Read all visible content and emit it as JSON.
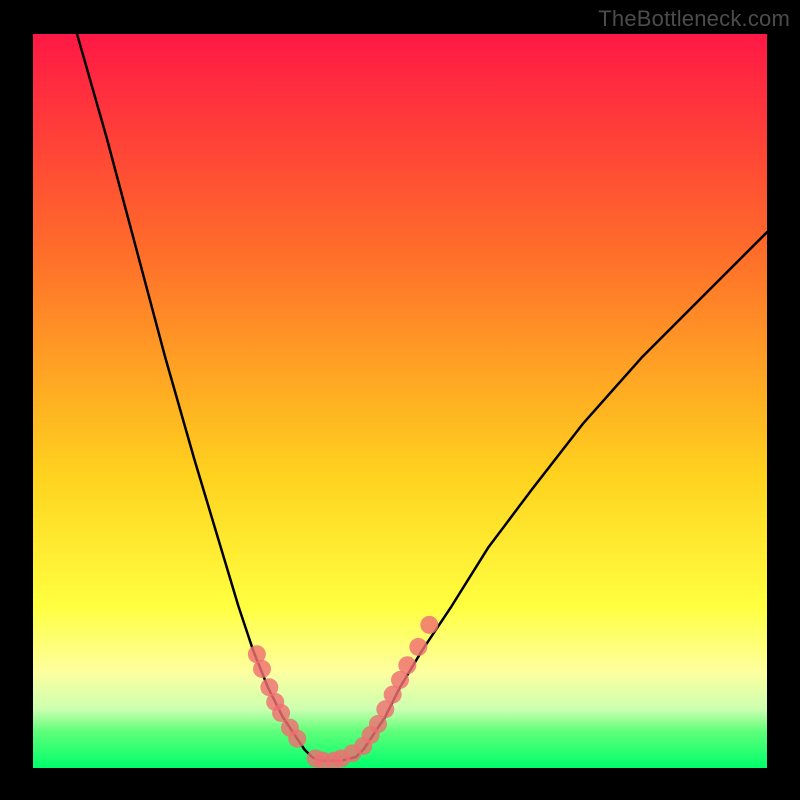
{
  "watermark": "TheBottleneck.com",
  "chart_data": {
    "type": "line",
    "title": "",
    "xlabel": "",
    "ylabel": "",
    "xlim": [
      0,
      100
    ],
    "ylim": [
      0,
      100
    ],
    "series": [
      {
        "name": "bottleneck-curve",
        "color": "#000000",
        "x": [
          6,
          10,
          14,
          18,
          22,
          25,
          28,
          30,
          32,
          34,
          36,
          37,
          38,
          39,
          40,
          42,
          44,
          45,
          46,
          48,
          50,
          53,
          57,
          62,
          68,
          75,
          83,
          92,
          100
        ],
        "y": [
          100,
          86,
          71,
          56,
          42,
          32,
          22,
          16,
          11,
          7,
          4,
          2.5,
          1.5,
          1,
          1,
          1,
          1.5,
          2.5,
          4,
          7,
          11,
          16,
          22,
          30,
          38,
          47,
          56,
          65,
          73
        ]
      }
    ],
    "marker_points": {
      "name": "scatter-points",
      "color": "#ef6f72",
      "radius_px": 9,
      "x": [
        30.5,
        31.2,
        32.2,
        33.0,
        33.8,
        35.0,
        36.0,
        38.5,
        39.5,
        41.0,
        42.0,
        43.5,
        45.0,
        46.0,
        47.0,
        48.0,
        49.0,
        50.0,
        51.0,
        52.5,
        54.0
      ],
      "y": [
        15.5,
        13.5,
        11.0,
        9.0,
        7.5,
        5.5,
        4.0,
        1.3,
        1.0,
        1.0,
        1.3,
        2.0,
        3.0,
        4.5,
        6.0,
        8.0,
        10.0,
        12.0,
        14.0,
        16.5,
        19.5
      ]
    }
  }
}
